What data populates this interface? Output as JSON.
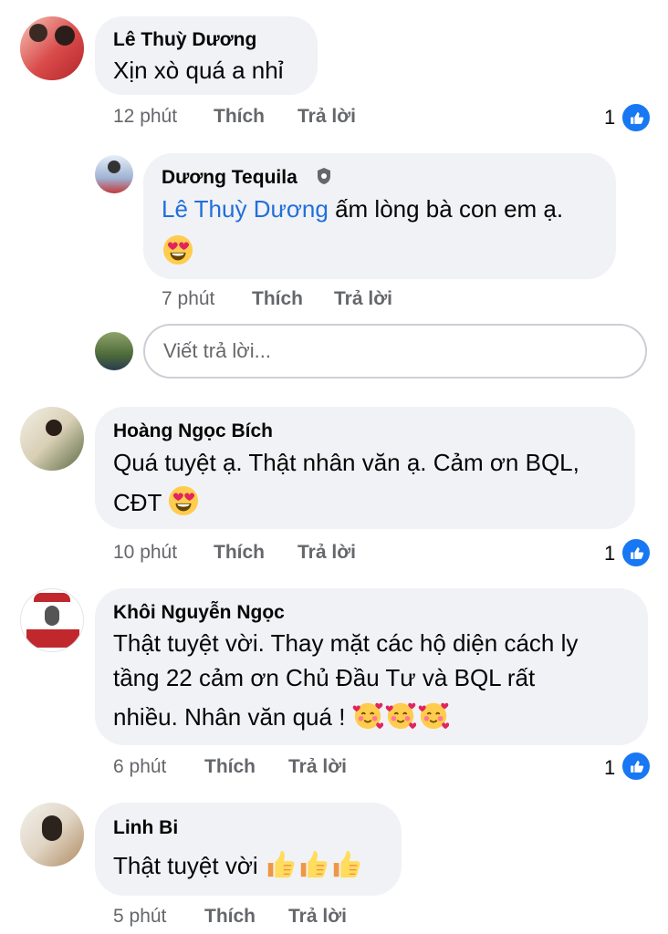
{
  "comments": [
    {
      "author": "Lê Thuỳ Dương",
      "text": "Xịn xò quá a nhỉ",
      "time": "12 phút",
      "like_label": "Thích",
      "reply_label": "Trả lời",
      "reaction_count": "1"
    },
    {
      "author": "Hoàng Ngọc Bích",
      "text_line1": "Quá tuyệt ạ. Thật nhân văn ạ. Cảm ơn BQL,",
      "text_line2": "CĐT",
      "time": "10 phút",
      "like_label": "Thích",
      "reply_label": "Trả lời",
      "reaction_count": "1"
    },
    {
      "author": "Khôi Nguyễn Ngọc",
      "text_line1": "Thật tuyệt vời. Thay mặt các hộ diện cách ly",
      "text_line2": "tầng 22 cảm ơn Chủ Đầu Tư và BQL rất",
      "text_line3": "nhiều. Nhân văn quá !",
      "time": "6 phút",
      "like_label": "Thích",
      "reply_label": "Trả lời",
      "reaction_count": "1"
    },
    {
      "author": "Linh Bi",
      "text": "Thật tuyệt vời",
      "time": "5 phút",
      "like_label": "Thích",
      "reply_label": "Trả lời"
    }
  ],
  "reply": {
    "author": "Dương Tequila",
    "mention": "Lê Thuỳ Dương",
    "text": " ấm lòng bà con em ạ.",
    "time": "7 phút",
    "like_label": "Thích",
    "reply_label": "Trả lời"
  },
  "reply_box": {
    "placeholder": "Viết trả lời..."
  },
  "colors": {
    "bubble": "#f0f2f5",
    "mention": "#216fdb",
    "meta": "#65676b",
    "like_badge": "#1877f2"
  },
  "icons": {
    "reaction": "like-thumb-icon",
    "admin_badge": "shield-badge-icon",
    "emoji_heart_eyes": "heart-eyes-emoji",
    "emoji_hearts": "smiling-face-with-hearts-emoji",
    "emoji_thumbs_up": "thumbs-up-emoji"
  }
}
